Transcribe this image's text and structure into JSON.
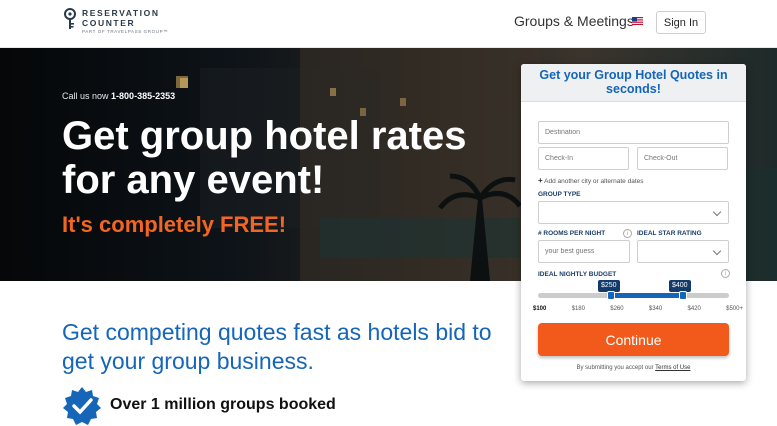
{
  "header": {
    "logo": {
      "line1": "RESERVATION",
      "line2": "COUNTER",
      "line3": "PART OF TRAVELPASS GROUP™"
    },
    "nav_groups": "Groups & Meetings",
    "flag_icon": "us-flag-icon",
    "signin": "Sign In"
  },
  "hero": {
    "call_prefix": "Call us now",
    "phone": "1-800-385-2353",
    "headline": "Get group hotel rates for any event!",
    "free": "It's completely FREE!"
  },
  "below": {
    "subheading": "Get competing quotes fast as hotels bid to get your group business.",
    "badge_text": "Over 1 million groups booked"
  },
  "form": {
    "title": "Get your Group Hotel Quotes in seconds!",
    "destination_placeholder": "Destination",
    "checkin_placeholder": "Check-In",
    "checkout_placeholder": "Check-Out",
    "add_city": "Add another city or alternate dates",
    "group_type_label": "GROUP TYPE",
    "rooms_label": "# ROOMS PER NIGHT",
    "rooms_placeholder": "your best guess",
    "star_label": "IDEAL STAR RATING",
    "budget_label": "IDEAL NIGHTLY BUDGET",
    "budget_min": "$250",
    "budget_max": "$400",
    "budget_ticks": [
      "$100",
      "$180",
      "$260",
      "$340",
      "$420",
      "$500+"
    ],
    "continue": "Continue",
    "terms_prefix": "By submitting you accept our",
    "terms_link": "Terms of Use"
  },
  "colors": {
    "brand_blue": "#1565b8",
    "accent_orange": "#f26522",
    "button_orange": "#f15a1a"
  }
}
